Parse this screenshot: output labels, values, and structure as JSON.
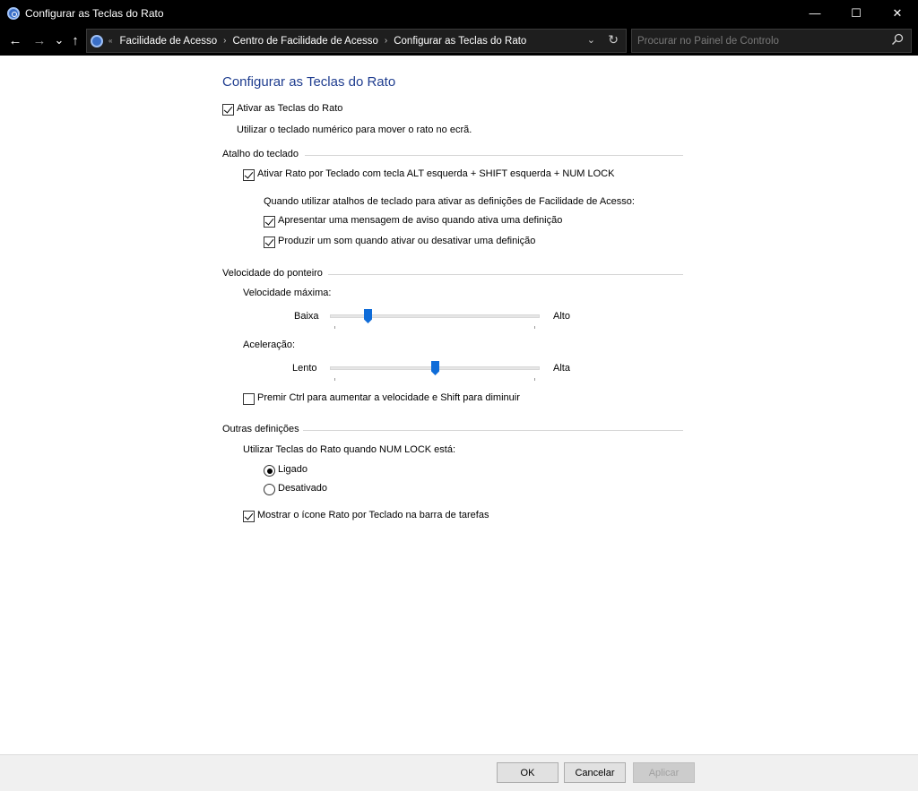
{
  "window": {
    "title": "Configurar as Teclas do Rato",
    "controls": {
      "minimize": "—",
      "maximize": "☐",
      "close": "✕"
    }
  },
  "nav": {
    "back_icon": "←",
    "forward_icon": "→",
    "recent_icon": "⌄",
    "up_icon": "↑",
    "breadcrumb": [
      "Facilidade de Acesso",
      "Centro de Facilidade de Acesso",
      "Configurar as Teclas do Rato"
    ],
    "overflow": "«",
    "dropdown_icon": "⌄",
    "refresh_icon": "↻",
    "search_placeholder": "Procurar no Painel de Controlo"
  },
  "main": {
    "title": "Configurar as Teclas do Rato",
    "enable_mouse_keys": {
      "label": "Ativar as Teclas do Rato",
      "checked": true
    },
    "enable_desc": "Utilizar o teclado numérico para mover o rato no ecrã.",
    "shortcut_group": {
      "label": "Atalho do teclado",
      "shortcut_cb": {
        "label": "Ativar Rato por Teclado com tecla ALT esquerda + SHIFT esquerda + NUM LOCK",
        "checked": true
      },
      "when_text": "Quando utilizar atalhos de teclado para ativar as definições de Facilidade de Acesso:",
      "warning_cb": {
        "label": "Apresentar uma mensagem de aviso quando ativa uma definição",
        "checked": true
      },
      "sound_cb": {
        "label": "Produzir um som quando ativar ou desativar uma definição",
        "checked": true
      }
    },
    "speed_group": {
      "label": "Velocidade do ponteiro",
      "max_speed": {
        "label": "Velocidade máxima:",
        "low": "Baixa",
        "high": "Alto",
        "value_fraction": 0.17
      },
      "acceleration": {
        "label": "Aceleração:",
        "low": "Lento",
        "high": "Alta",
        "value_fraction": 0.5
      },
      "ctrl_cb": {
        "label": "Premir Ctrl para aumentar a velocidade e Shift para diminuir",
        "checked": false
      }
    },
    "other_group": {
      "label": "Outras definições",
      "numlock_text": "Utilizar Teclas do Rato quando NUM LOCK está:",
      "on": {
        "label": "Ligado",
        "selected": true
      },
      "off": {
        "label": "Desativado",
        "selected": false
      },
      "tray_cb": {
        "label": "Mostrar o ícone Rato por Teclado na barra de tarefas",
        "checked": true
      }
    }
  },
  "footer": {
    "ok": "OK",
    "cancel": "Cancelar",
    "apply": "Aplicar"
  },
  "colors": {
    "title_blue": "#1f3d8f",
    "slider_thumb": "#0f6cd8",
    "chrome": "#000000"
  }
}
